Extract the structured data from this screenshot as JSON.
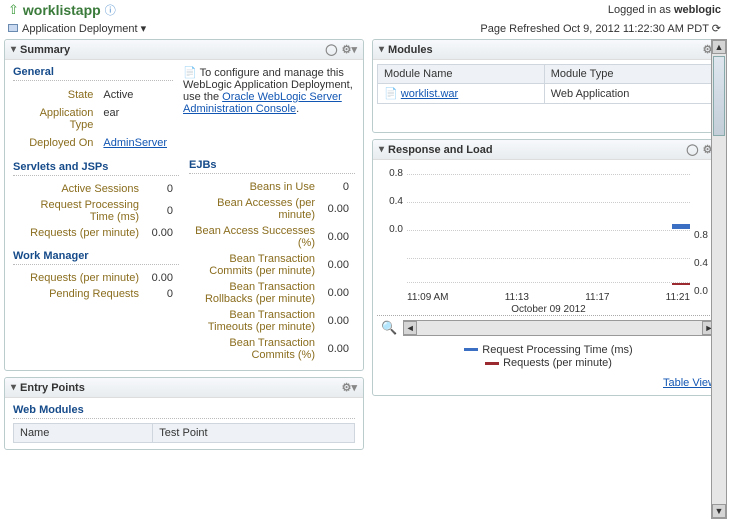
{
  "header": {
    "app_name": "worklistapp",
    "logged_in_prefix": "Logged in as",
    "user": "weblogic"
  },
  "subheader": {
    "deploy_label": "Application Deployment",
    "refresh_prefix": "Page Refreshed",
    "refresh_time": "Oct 9, 2012 11:22:30 AM PDT"
  },
  "summary": {
    "title": "Summary",
    "general_title": "General",
    "state_label": "State",
    "state": "Active",
    "app_type_label": "Application Type",
    "app_type": "ear",
    "deployed_on_label": "Deployed On",
    "deployed_on": "AdminServer",
    "hint_prefix": "To configure and manage this WebLogic Application Deployment, use the ",
    "hint_link": "Oracle WebLogic Server Administration Console",
    "hint_suffix": ".",
    "servlets_title": "Servlets and JSPs",
    "active_sessions_label": "Active Sessions",
    "active_sessions": "0",
    "req_proc_label": "Request Processing Time (ms)",
    "req_proc": "0",
    "req_pm_label": "Requests (per minute)",
    "req_pm": "0.00",
    "wm_title": "Work Manager",
    "wm_req_label": "Requests (per minute)",
    "wm_req": "0.00",
    "wm_pending_label": "Pending Requests",
    "wm_pending": "0",
    "ejb_title": "EJBs",
    "ejb": {
      "beans_in_use_label": "Beans in Use",
      "beans_in_use": "0",
      "accesses_label": "Bean Accesses (per minute)",
      "accesses": "0.00",
      "success_label": "Bean Access Successes (%)",
      "success": "0.00",
      "commits_label": "Bean Transaction Commits (per minute)",
      "commits": "0.00",
      "rollbacks_label": "Bean Transaction Rollbacks (per minute)",
      "rollbacks": "0.00",
      "timeouts_label": "Bean Transaction Timeouts (per minute)",
      "timeouts": "0.00",
      "commits_pct_label": "Bean Transaction Commits (%)",
      "commits_pct": "0.00"
    }
  },
  "entry_points": {
    "title": "Entry Points",
    "web_modules_title": "Web Modules",
    "col_name": "Name",
    "col_test": "Test Point"
  },
  "modules": {
    "title": "Modules",
    "col_name": "Module Name",
    "col_type": "Module Type",
    "row_name": "worklist.war",
    "row_type": "Web Application"
  },
  "response": {
    "title": "Response and Load",
    "legend1": "Request Processing Time (ms)",
    "legend2": "Requests (per minute)",
    "table_view": "Table View",
    "x": [
      "11:09 AM",
      "11:13",
      "11:17",
      "11:21"
    ],
    "x_sub": "October 09 2012",
    "y_left": [
      "0.8",
      "0.4",
      "0.0"
    ],
    "y_right": [
      "0.8",
      "0.4",
      "0.0"
    ]
  },
  "chart_data": [
    {
      "type": "line",
      "title": "Response and Load",
      "xlabel": "October 09 2012",
      "x": [
        "11:09 AM",
        "11:13",
        "11:17",
        "11:21"
      ],
      "series": [
        {
          "name": "Request Processing Time (ms)",
          "color": "#3a6fc4",
          "values": [
            0,
            0,
            0,
            0
          ],
          "axis": "left"
        },
        {
          "name": "Requests (per minute)",
          "color": "#9a2a2f",
          "values": [
            0,
            0,
            0,
            0
          ],
          "axis": "right"
        }
      ],
      "ylim_left": [
        0,
        1.0
      ],
      "ylim_right": [
        0,
        1.0
      ]
    }
  ]
}
